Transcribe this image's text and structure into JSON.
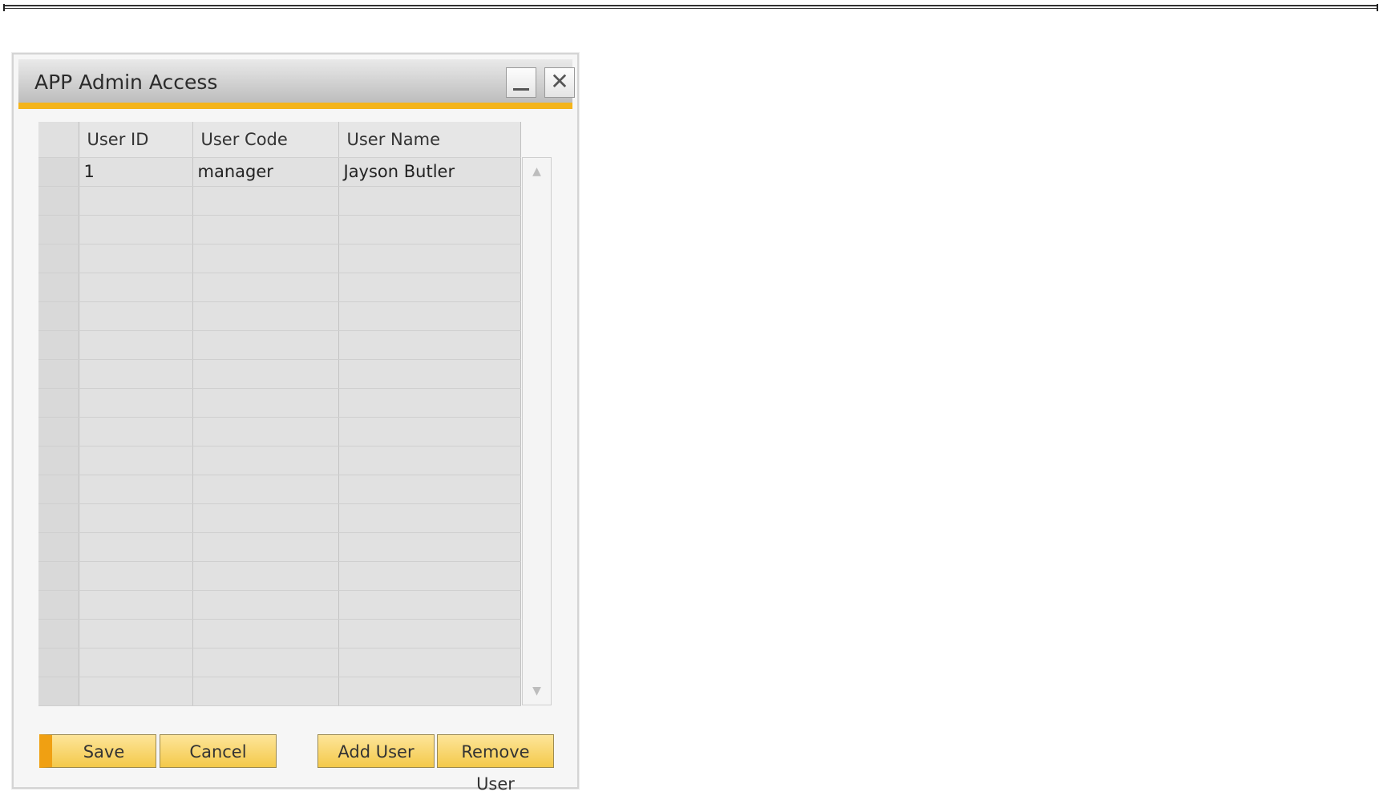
{
  "window": {
    "title": "APP Admin Access",
    "close_glyph": "✕"
  },
  "grid": {
    "columns": [
      "",
      "User ID",
      "User Code",
      "User Name"
    ],
    "rows": [
      {
        "id": "1",
        "code": "manager",
        "name": "Jayson Butler"
      }
    ],
    "total_visible_rows": 19
  },
  "buttons": {
    "save": "Save",
    "cancel": "Cancel",
    "add_user": "Add User",
    "remove_user": "Remove User"
  },
  "scrollbar": {
    "up_glyph": "▲",
    "down_glyph": "▼"
  },
  "colors": {
    "accent": "#f4b41a",
    "button_top": "#fde59a",
    "button_bottom": "#f4c94a",
    "grid_cell": "#e1e1e1"
  }
}
